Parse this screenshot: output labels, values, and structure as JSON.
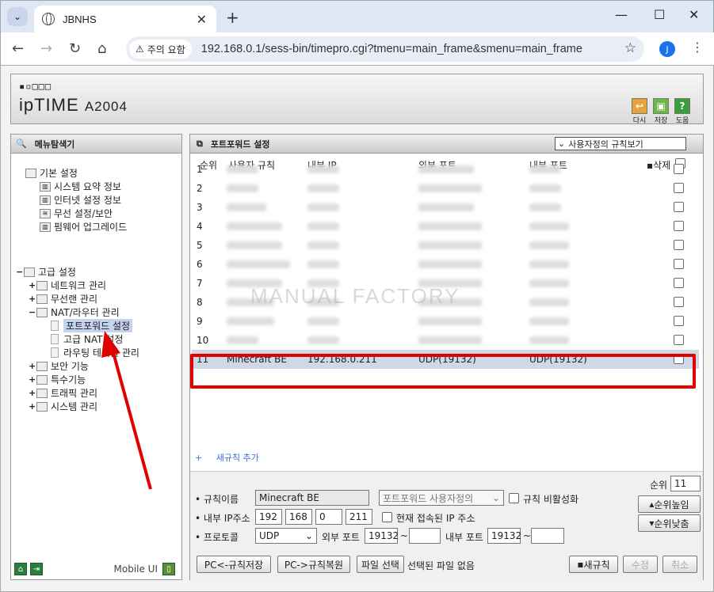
{
  "browser": {
    "tab_title": "JBNHS",
    "url": "192.168.0.1/sess-bin/timepro.cgi?tmenu=main_frame&smenu=main_frame",
    "security_label": "주의 요함",
    "avatar_letter": "J"
  },
  "header": {
    "logo_dots": "▪▫□□□",
    "logo": "ipTIME",
    "model": "A2004",
    "buttons": [
      {
        "label": "다시",
        "color": "#e8a33a"
      },
      {
        "label": "저장",
        "color": "#6bb845"
      },
      {
        "label": "도움",
        "color": "#3c9d3c"
      }
    ]
  },
  "sidebar": {
    "title": "메뉴탐색기",
    "basic": {
      "label": "기본 설정",
      "items": [
        "시스템 요약 정보",
        "인터넷 설정 정보",
        "무선 설정/보안",
        "펌웨어 업그레이드"
      ]
    },
    "advanced": {
      "label": "고급 설정",
      "items": [
        "네트워크 관리",
        "무선랜 관리",
        "NAT/라우터 관리",
        "포트포워드 설정",
        "고급 NAT 설정",
        "라우팅 테이블 관리",
        "보안 기능",
        "특수기능",
        "트래픽 관리",
        "시스템 관리"
      ]
    },
    "mobile": "Mobile UI"
  },
  "main": {
    "title": "포트포워드 설정",
    "view_select": "사용자정의 규칙보기",
    "columns": [
      "순위",
      "사용자 규칙",
      "내부 IP",
      "외부 포트",
      "내부 포트",
      "삭제"
    ],
    "rows": [
      {
        "rank": "1"
      },
      {
        "rank": "2"
      },
      {
        "rank": "3"
      },
      {
        "rank": "4"
      },
      {
        "rank": "5"
      },
      {
        "rank": "6"
      },
      {
        "rank": "7"
      },
      {
        "rank": "8"
      },
      {
        "rank": "9"
      },
      {
        "rank": "10"
      },
      {
        "rank": "11",
        "name": "Minecraft BE",
        "ip": "192.168.0.211",
        "ext": "UDP(19132)",
        "int": "UDP(19132)"
      }
    ],
    "add_rule": "새규칙 추가",
    "watermark": "MANUAL FACTORY"
  },
  "form": {
    "rule_name_label": "규칙이름",
    "rule_name": "Minecraft BE",
    "preset": "포트포워드 사용자정의",
    "disable_label": "규칙 비활성화",
    "ip_label": "내부 IP주소",
    "ip": [
      "192",
      "168",
      "0",
      "211"
    ],
    "current_ip_label": "현재 접속된 IP 주소",
    "proto_label": "프로토콜",
    "proto": "UDP",
    "ext_label": "외부 포트",
    "ext_port": "19132",
    "int_label": "내부 포트",
    "int_port": "19132",
    "rank_label": "순위",
    "rank": "11",
    "up": "순위높임",
    "down": "순위낮춤",
    "save_pc": "PC<-규칙저장",
    "restore_pc": "PC->규칙복원",
    "file_select": "파일 선택",
    "no_file": "선택된 파일 없음",
    "new_rule": "새규칙",
    "modify": "수정",
    "cancel": "취소"
  }
}
